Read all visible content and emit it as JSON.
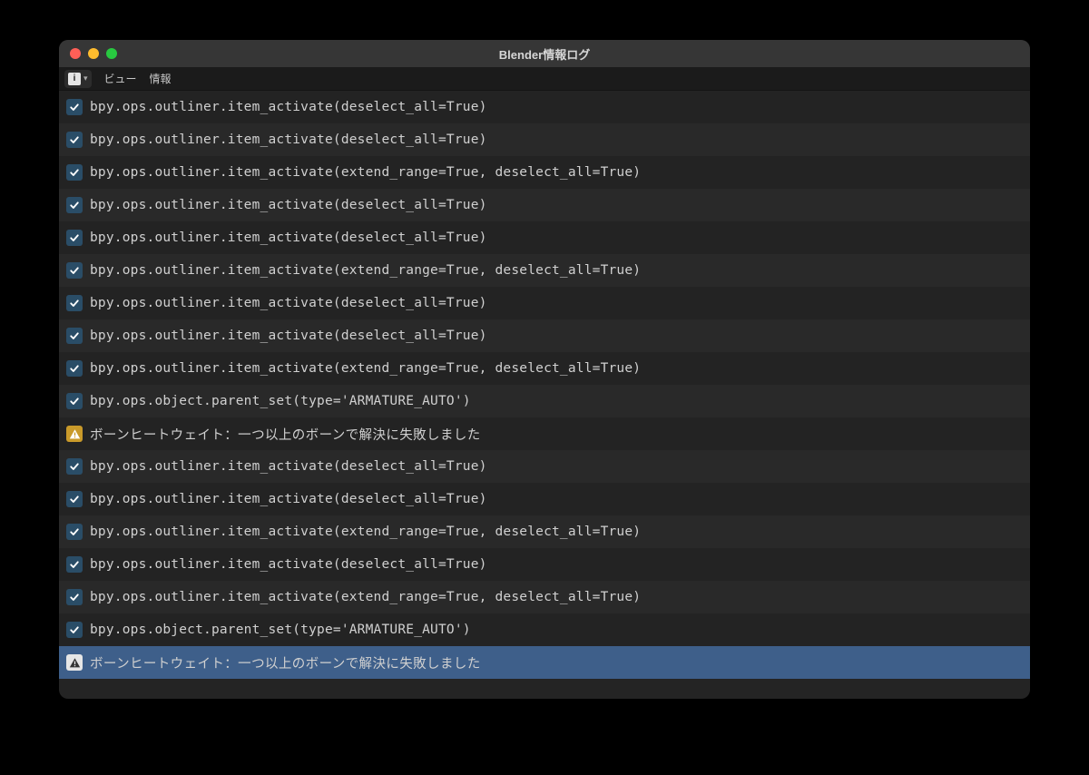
{
  "window": {
    "title": "Blender情報ログ"
  },
  "toolbar": {
    "editor_icon": "i",
    "menu_view": "ビュー",
    "menu_info": "情報"
  },
  "log": [
    {
      "type": "info",
      "text": "bpy.ops.outliner.item_activate(deselect_all=True)"
    },
    {
      "type": "info",
      "text": "bpy.ops.outliner.item_activate(deselect_all=True)"
    },
    {
      "type": "info",
      "text": "bpy.ops.outliner.item_activate(extend_range=True, deselect_all=True)"
    },
    {
      "type": "info",
      "text": "bpy.ops.outliner.item_activate(deselect_all=True)"
    },
    {
      "type": "info",
      "text": "bpy.ops.outliner.item_activate(deselect_all=True)"
    },
    {
      "type": "info",
      "text": "bpy.ops.outliner.item_activate(extend_range=True, deselect_all=True)"
    },
    {
      "type": "info",
      "text": "bpy.ops.outliner.item_activate(deselect_all=True)"
    },
    {
      "type": "info",
      "text": "bpy.ops.outliner.item_activate(deselect_all=True)"
    },
    {
      "type": "info",
      "text": "bpy.ops.outliner.item_activate(extend_range=True, deselect_all=True)"
    },
    {
      "type": "info",
      "text": "bpy.ops.object.parent_set(type='ARMATURE_AUTO')"
    },
    {
      "type": "warn",
      "text": "ボーンヒートウェイト：一つ以上のボーンで解決に失敗しました"
    },
    {
      "type": "info",
      "text": "bpy.ops.outliner.item_activate(deselect_all=True)"
    },
    {
      "type": "info",
      "text": "bpy.ops.outliner.item_activate(deselect_all=True)"
    },
    {
      "type": "info",
      "text": "bpy.ops.outliner.item_activate(extend_range=True, deselect_all=True)"
    },
    {
      "type": "info",
      "text": "bpy.ops.outliner.item_activate(deselect_all=True)"
    },
    {
      "type": "info",
      "text": "bpy.ops.outliner.item_activate(extend_range=True, deselect_all=True)"
    },
    {
      "type": "info",
      "text": "bpy.ops.object.parent_set(type='ARMATURE_AUTO')"
    },
    {
      "type": "warn",
      "text": "ボーンヒートウェイト：一つ以上のボーンで解決に失敗しました",
      "selected": true
    }
  ]
}
